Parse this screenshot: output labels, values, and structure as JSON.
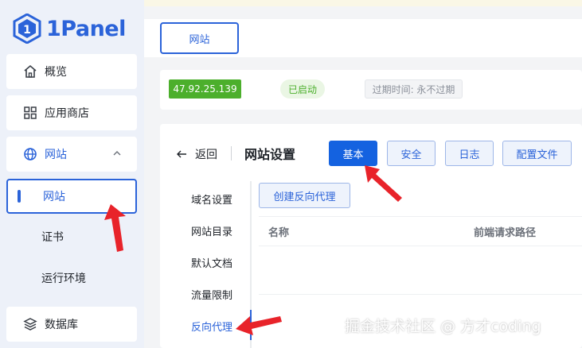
{
  "brand": {
    "name": "1Panel",
    "color": "#2b63d9"
  },
  "sidebar": {
    "items": [
      {
        "label": "概览",
        "icon": "home-icon"
      },
      {
        "label": "应用商店",
        "icon": "app-grid-icon"
      },
      {
        "label": "网站",
        "icon": "globe-icon",
        "expanded": true
      },
      {
        "label": "数据库",
        "icon": "database-layers-icon"
      }
    ],
    "sub_items": [
      {
        "label": "网站",
        "active": true
      },
      {
        "label": "证书"
      },
      {
        "label": "运行环境"
      }
    ]
  },
  "tabs": [
    {
      "label": "网站",
      "active": true
    }
  ],
  "site_info": {
    "ip": "47.92.25.139",
    "status": "已启动",
    "expire": "过期时间: 永不过期"
  },
  "header": {
    "back_label": "返回",
    "title": "网站设置",
    "buttons": [
      {
        "label": "基本",
        "primary": true
      },
      {
        "label": "安全"
      },
      {
        "label": "日志"
      },
      {
        "label": "配置文件"
      }
    ]
  },
  "menu": [
    {
      "label": "域名设置"
    },
    {
      "label": "网站目录"
    },
    {
      "label": "默认文档"
    },
    {
      "label": "流量限制"
    },
    {
      "label": "反向代理",
      "active": true
    }
  ],
  "proxy": {
    "create_label": "创建反向代理",
    "columns": [
      "名称",
      "前端请求路径"
    ]
  },
  "watermark": "掘金技术社区 @ 方才coding",
  "colors": {
    "accent": "#2b63d9",
    "primary_button": "#1462e0",
    "success": "#4caf2c",
    "annotation_arrow": "#e8232a"
  }
}
